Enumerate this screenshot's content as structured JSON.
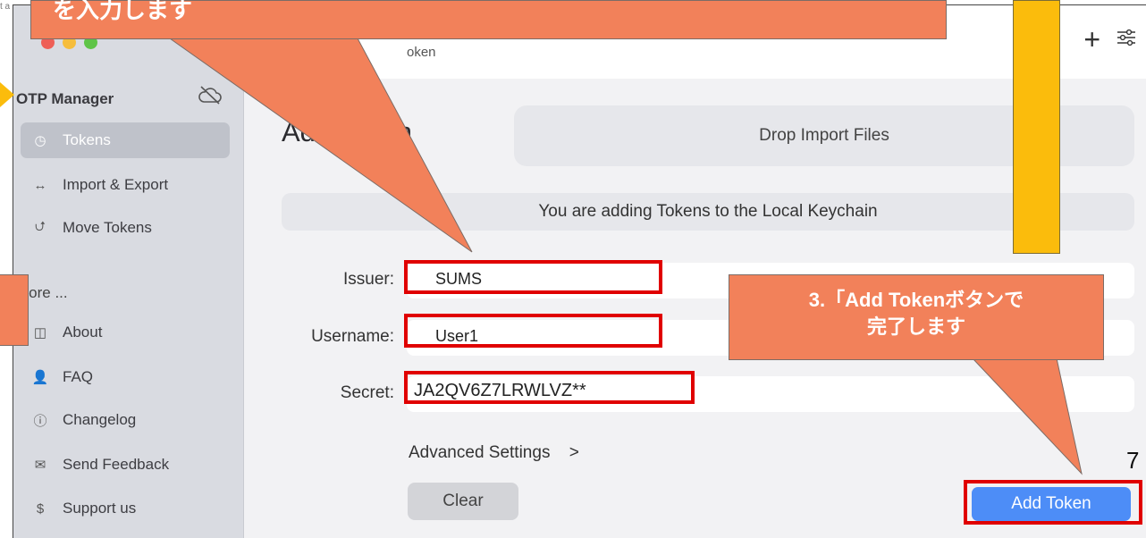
{
  "clipped_text": "t a",
  "window": {
    "topbar_subtitle": "oken",
    "plus_icon": "plus-icon",
    "settings_icon": "sliders-icon"
  },
  "sidebar": {
    "title": "OTP Manager",
    "cloud_icon": "cloud-slash-icon",
    "items": [
      {
        "label": "Tokens",
        "icon": "◷",
        "active": true
      },
      {
        "label": "Import & Export",
        "icon": "↔",
        "active": false
      },
      {
        "label": "Move Tokens",
        "icon": "⮍",
        "active": false
      }
    ],
    "more_title": "More ...",
    "more_items": [
      {
        "label": "About",
        "icon": "◫"
      },
      {
        "label": "FAQ",
        "icon": "👤"
      },
      {
        "label": "Changelog",
        "icon": "ⓘ"
      },
      {
        "label": "Send Feedback",
        "icon": "✉"
      },
      {
        "label": "Support us",
        "icon": "$"
      }
    ]
  },
  "main": {
    "page_title": "Add Token",
    "drop_label": "Drop Import Files",
    "keychain_notice": "You are adding Tokens to the Local Keychain",
    "fields": [
      {
        "label": "Issuer:",
        "value": "SUMS"
      },
      {
        "label": "Username:",
        "value": "User1"
      },
      {
        "label": "Secret:",
        "value": "JA2QV6Z7LRWLVZ**"
      }
    ],
    "advanced_label": "Advanced Settings",
    "advanced_chevron": ">",
    "clear_label": "Clear",
    "add_label": "Add Token"
  },
  "annotations": {
    "note_top": "を入力します",
    "note_add_line1": "3.「Add Tokenボタンで",
    "note_add_line2": "完了します",
    "page_number": "7",
    "colors": {
      "callout": "#f2815a",
      "frame": "#e00000",
      "highlight": "#fbbc0c"
    }
  }
}
